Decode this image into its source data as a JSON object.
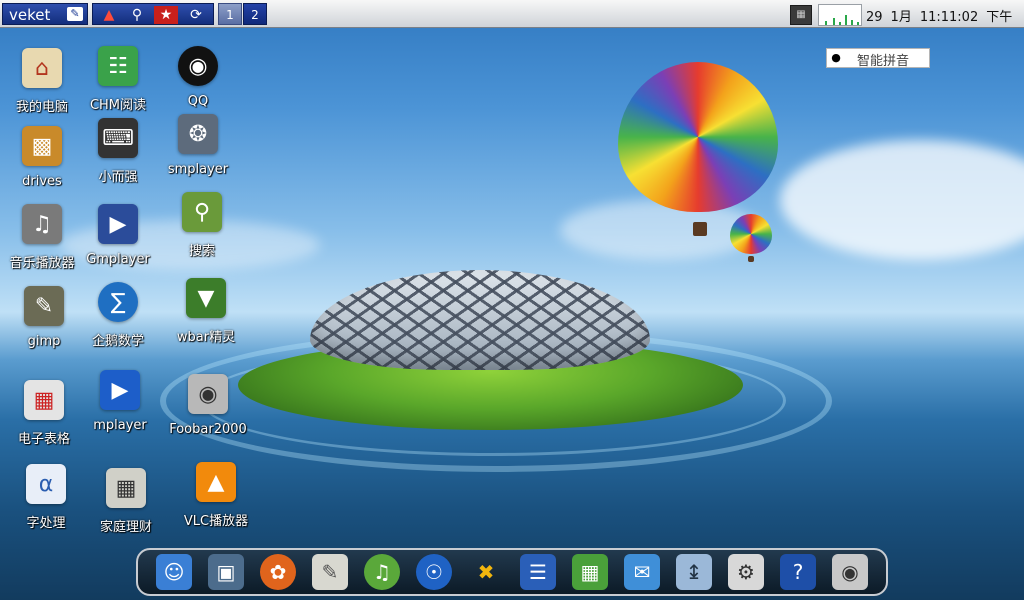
{
  "top_panel": {
    "menu_label": "veket",
    "menu_icon": "app-menu-icon",
    "quick_launch": [
      "network-icon",
      "search-icon",
      "flag-icon",
      "refresh-icon"
    ],
    "workspaces": [
      "1",
      "2"
    ],
    "active_workspace": "2",
    "clock": {
      "day": "29",
      "month": "1月",
      "time": "11:11:02",
      "period": "下午"
    }
  },
  "ime": {
    "label": "智能拼音",
    "icon": "penguin-icon"
  },
  "desktop_icons": [
    {
      "label": "我的电脑",
      "icon": "home-icon"
    },
    {
      "label": "CHM阅读",
      "icon": "books-icon"
    },
    {
      "label": "QQ",
      "icon": "qq-penguin-icon"
    },
    {
      "label": "drives",
      "icon": "drive-box-icon"
    },
    {
      "label": "小而强",
      "icon": "remote-icon"
    },
    {
      "label": "smplayer",
      "icon": "film-reel-icon"
    },
    {
      "label": "音乐播放器",
      "icon": "speaker-icon"
    },
    {
      "label": "Gmplayer",
      "icon": "clapper-icon"
    },
    {
      "label": "搜索",
      "icon": "search-monitor-icon"
    },
    {
      "label": "gimp",
      "icon": "gimp-icon"
    },
    {
      "label": "企鹅数学",
      "icon": "penguin-math-icon"
    },
    {
      "label": "wbar精灵",
      "icon": "wbar-icon"
    },
    {
      "label": "电子表格",
      "icon": "spreadsheet-icon"
    },
    {
      "label": "mplayer",
      "icon": "clapper-blue-icon"
    },
    {
      "label": "Foobar2000",
      "icon": "speakers-icon"
    },
    {
      "label": "字处理",
      "icon": "word-processor-icon"
    },
    {
      "label": "家庭理财",
      "icon": "calculator-icon"
    },
    {
      "label": "VLC播放器",
      "icon": "vlc-cone-icon"
    }
  ],
  "dock_items": [
    "finder-icon",
    "monitor-icon",
    "firefox-icon",
    "document-icon",
    "music-disc-icon",
    "globe-icon",
    "runner-icon",
    "text-document-icon",
    "spreadsheet-icon",
    "chat-icon",
    "usb-drive-icon",
    "installer-icon",
    "help-shield-icon",
    "camera-icon"
  ]
}
